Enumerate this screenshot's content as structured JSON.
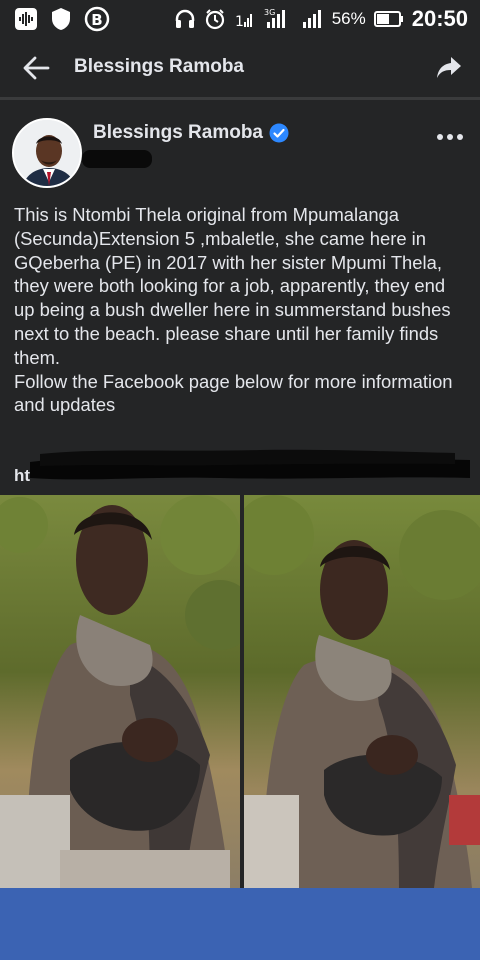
{
  "status_bar": {
    "battery_percent": "56%",
    "network": "3G",
    "time": "20:50"
  },
  "header": {
    "title": "Blessings Ramoba"
  },
  "post": {
    "author": "Blessings Ramoba",
    "text": "This is Ntombi Thela original from Mpumalanga (Secunda)Extension 5 ,mbaletle, she came here in GQeberha (PE) in 2017 with her sister Mpumi Thela, they were both looking for a job, apparently, they end up being a bush dweller here in summerstand bushes next to the beach. please share until her family finds them.\nFollow the Facebook page below for more information and updates",
    "link_visible": "ht"
  },
  "colors": {
    "background": "#242526",
    "verified": "#2d88ff",
    "bottom_bar": "#3b63b3"
  }
}
